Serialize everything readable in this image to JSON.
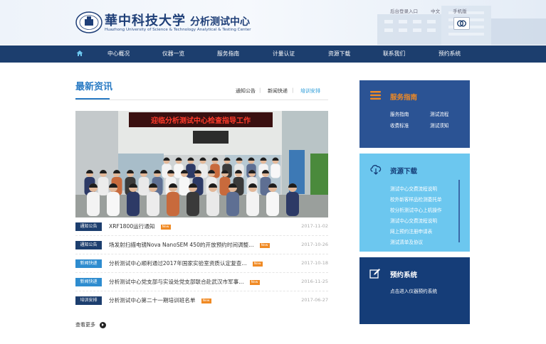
{
  "header": {
    "logo_cn": "華中科技大学",
    "logo_sub": "分析测试中心",
    "logo_en": "Huazhong University of Science & Technology Analytical & Testing Center",
    "top_links": [
      "后台登录入口",
      "中文",
      "手机版"
    ]
  },
  "nav": {
    "items": [
      "中心概况",
      "仪器一览",
      "服务指南",
      "计量认证",
      "资源下载",
      "联系我们",
      "预约系统"
    ]
  },
  "news": {
    "section_title": "最新资讯",
    "tabs": [
      "通知公告",
      "新闻快递",
      "培训安排"
    ],
    "photo_banner": "迎临分析测试中心检查指导工作",
    "items": [
      {
        "tag": "通知公告",
        "title": "XRF1800运行通知",
        "date": "2017-11-02",
        "new": true
      },
      {
        "tag": "通知公告",
        "title": "场发射扫描电镜Nova NanoSEM 450的开放预约时间调整...",
        "date": "2017-10-26",
        "new": true
      },
      {
        "tag": "新闻快递",
        "title": "分析测试中心顺利通过2017年国家实验室资质认定复查...",
        "date": "2017-10-18",
        "new": true
      },
      {
        "tag": "新闻快递",
        "title": "分析测试中心党支部与实设处党支部联合赴武汉市军事...",
        "date": "2016-11-25",
        "new": true
      },
      {
        "tag": "培训安排",
        "title": "分析测试中心第二十一期培训班名单",
        "date": "2017-06-27",
        "new": true
      }
    ],
    "new_badge": "New",
    "more_label": "查看更多"
  },
  "service": {
    "title": "服务指南",
    "links": [
      "服务指南",
      "测试流程",
      "收费标准",
      "测试须知"
    ]
  },
  "resources": {
    "title": "资源下载",
    "links": [
      "测试中心交费流程说明",
      "校外新客样品检测委托单",
      "校分析测试中心上机操作",
      "测试中心交费流程说明",
      "网上预约注册申请表",
      "测试清单及协议"
    ]
  },
  "booking": {
    "title": "预约系统",
    "desc": "点击进入仪器预约系统"
  },
  "colors": {
    "nav_bg": "#1c3e6e",
    "accent_blue": "#2a7bc4",
    "panel_service": "#2b5394",
    "panel_resources": "#6cc7ef",
    "panel_booking": "#153d78",
    "orange": "#f08a24",
    "tag_navy": "#1c3e6e",
    "tag_blue": "#2e8ccf"
  },
  "icons": [
    "home-icon",
    "search-icon",
    "service-icon",
    "cloud-download-icon",
    "edit-icon",
    "arrow-right-icon"
  ]
}
